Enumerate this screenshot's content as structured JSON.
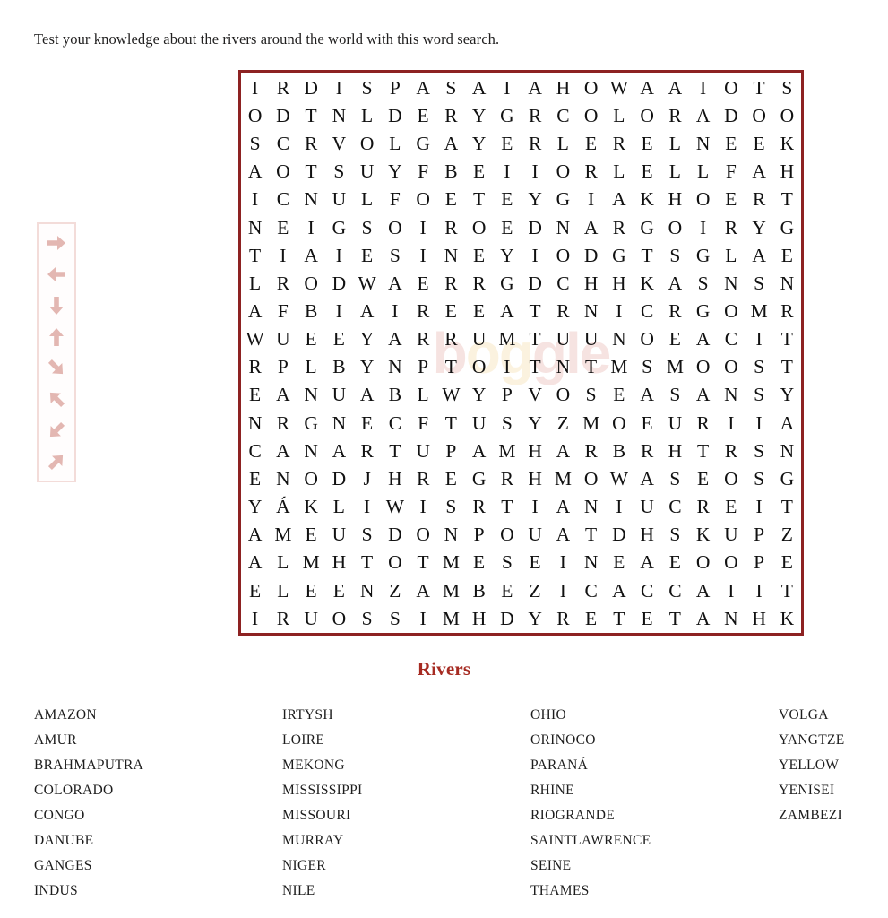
{
  "instructions": "Test your knowledge about the rivers around the world with this word search.",
  "puzzle_title": "Rivers",
  "colors": {
    "grid_border": "#8d2222",
    "title": "#a62b22",
    "legend_border": "#f3dcd9",
    "legend_arrow": "#e3b7b2",
    "letter": "#111111",
    "text": "#1d1d1d",
    "background": "#ffffff"
  },
  "watermark": {
    "text": "bogglesworldesl",
    "visible_fragment": "og"
  },
  "legend": {
    "label": "search directions",
    "arrows": [
      {
        "name": "arrow-right-icon",
        "direction": "right",
        "rotation": 0
      },
      {
        "name": "arrow-left-icon",
        "direction": "left",
        "rotation": 180
      },
      {
        "name": "arrow-down-icon",
        "direction": "down",
        "rotation": 90
      },
      {
        "name": "arrow-up-icon",
        "direction": "up",
        "rotation": 270
      },
      {
        "name": "arrow-down-right-icon",
        "direction": "down-right",
        "rotation": 45
      },
      {
        "name": "arrow-up-left-icon",
        "direction": "up-left",
        "rotation": 225
      },
      {
        "name": "arrow-down-left-icon",
        "direction": "down-left",
        "rotation": 135
      },
      {
        "name": "arrow-up-right-icon",
        "direction": "up-right",
        "rotation": 315
      }
    ]
  },
  "grid": {
    "rows": 20,
    "cols": 20,
    "letters": [
      "IRDISPASAIAHOWAAIOTS",
      "ODTNLDERYGRCOLORADOO",
      "SCRVOLGAYERLERELNEEK",
      "AOTSUYFBEIIORLELLFAH",
      "ICNULFOETEYGIAKHOERT",
      "NEIGSOIROEDNARGOIRYG",
      "TIAIESINEYIODGTSGLAE",
      "LRODWAERRGDCHHKASNSN",
      "AFBIAIREEATRNICRGOMR",
      "WUEEYARRUMTUUNOEACIT",
      "RPLBYNPTOITNTMSMOOST",
      "EANUABLWYPVOSEASANSY",
      "NRGNECFTUSYZMOEURIIA",
      "CANARTUPAMHARBRHTRSN",
      "ENODJHREGRHMOWASEOSG",
      "YÁKLIWISRTIANIUCREIT",
      "AMEUSDONPOUATDHSKUPZ",
      "ALMHTOTMESEINEAEOOPE",
      "ELEENZAMBEZICACCAIIT",
      "IRUOSSIMHDYRETETANHK"
    ]
  },
  "word_list": {
    "columns": [
      [
        "AMAZON",
        "AMUR",
        "BRAHMAPUTRA",
        "COLORADO",
        "CONGO",
        "DANUBE",
        "GANGES",
        "INDUS"
      ],
      [
        "IRTYSH",
        "LOIRE",
        "MEKONG",
        "MISSISSIPPI",
        "MISSOURI",
        "MURRAY",
        "NIGER",
        "NILE"
      ],
      [
        "OHIO",
        "ORINOCO",
        "PARANÁ",
        "RHINE",
        "RIOGRANDE",
        "SAINTLAWRENCE",
        "SEINE",
        "THAMES"
      ],
      [
        "VOLGA",
        "YANGTZE",
        "YELLOW",
        "YENISEI",
        "ZAMBEZI"
      ]
    ]
  }
}
